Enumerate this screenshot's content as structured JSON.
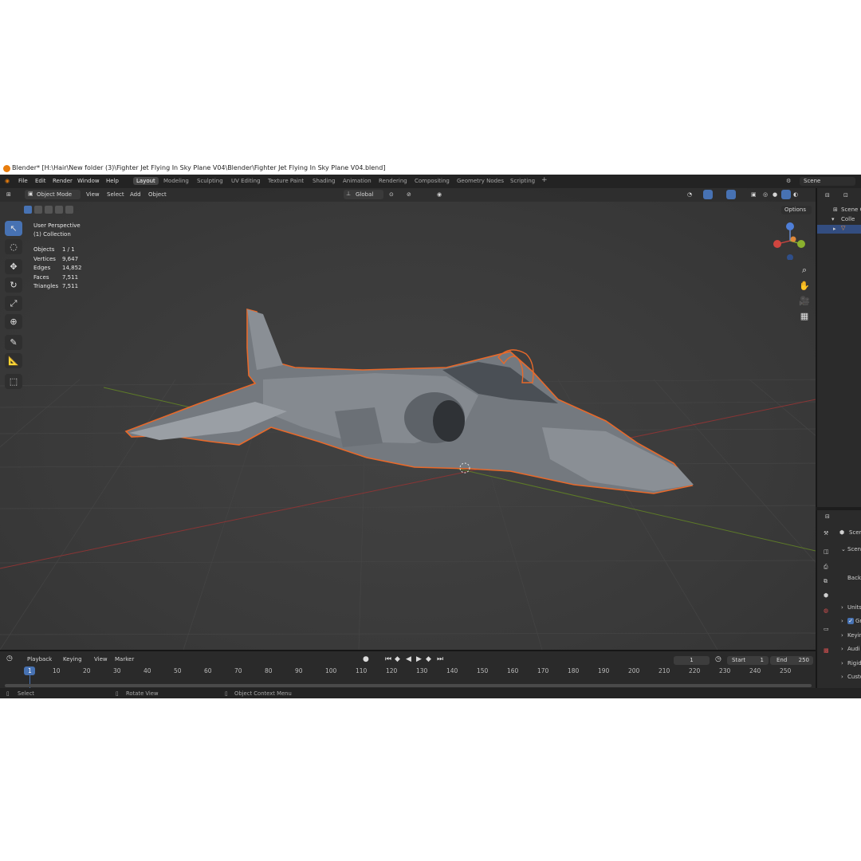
{
  "window": {
    "title": "Blender* [H:\\Hair\\New folder (3)\\Fighter Jet Flying In Sky Plane V04\\Blender\\Fighter Jet Flying In Sky Plane V04.blend]"
  },
  "menu": [
    "File",
    "Edit",
    "Render",
    "Window",
    "Help"
  ],
  "workspaces": [
    "Layout",
    "Modeling",
    "Sculpting",
    "UV Editing",
    "Texture Paint",
    "Shading",
    "Animation",
    "Rendering",
    "Compositing",
    "Geometry Nodes",
    "Scripting",
    "+"
  ],
  "scene_selector": "Scene",
  "viewport_header": {
    "mode": "Object Mode",
    "menus": [
      "View",
      "Select",
      "Add",
      "Object"
    ],
    "transform_orientation": "Global",
    "options": "Options"
  },
  "overlay": {
    "perspective": "User Perspective",
    "collection": "(1) Collection",
    "stats": [
      {
        "label": "Objects",
        "value": "1 / 1"
      },
      {
        "label": "Vertices",
        "value": "9,647"
      },
      {
        "label": "Edges",
        "value": "14,852"
      },
      {
        "label": "Faces",
        "value": "7,511"
      },
      {
        "label": "Triangles",
        "value": "7,511"
      }
    ]
  },
  "outliner": {
    "header": "Scene C",
    "items": [
      "Colle"
    ]
  },
  "properties": {
    "tab_title": "Scer",
    "section": "Scene",
    "field": "Backg",
    "panels": [
      "Units",
      "Gr",
      "Keyin",
      "Audi",
      "Rigid",
      "Custo"
    ]
  },
  "timeline": {
    "menus": [
      "Playback",
      "Keying",
      "View",
      "Marker"
    ],
    "current_frame": "1",
    "start_label": "Start",
    "start": "1",
    "end_label": "End",
    "end": "250",
    "ticks": [
      "1",
      "10",
      "20",
      "30",
      "40",
      "50",
      "60",
      "70",
      "80",
      "90",
      "100",
      "110",
      "120",
      "130",
      "140",
      "150",
      "160",
      "170",
      "180",
      "190",
      "200",
      "210",
      "220",
      "230",
      "240",
      "250"
    ]
  },
  "statusbar": [
    "Select",
    "Rotate View",
    "Object Context Menu"
  ],
  "colors": {
    "accent_blue": "#4772b3",
    "selection_orange": "#e8692a",
    "axis_red": "#a03a3a",
    "axis_green": "#6b8a2a"
  }
}
